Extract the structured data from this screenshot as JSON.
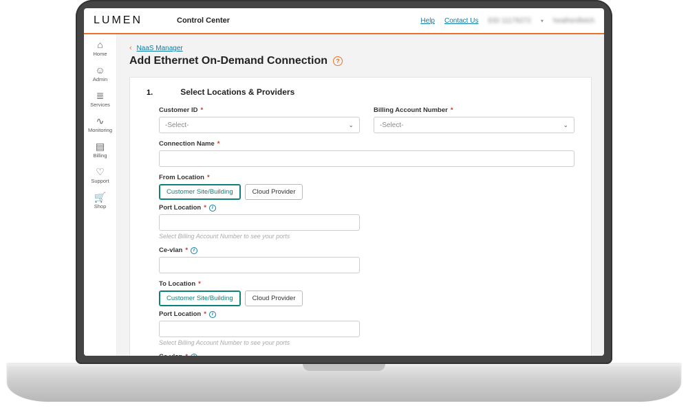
{
  "header": {
    "brand": "LUMEN",
    "app_name": "Control Center",
    "links": {
      "help": "Help",
      "contact": "Contact Us",
      "account_id": "EID 11179272",
      "user_name": "heathenfletch"
    }
  },
  "sidebar": [
    {
      "key": "home",
      "label": "Home",
      "icon": "⌂"
    },
    {
      "key": "admin",
      "label": "Admin",
      "icon": "☺"
    },
    {
      "key": "services",
      "label": "Services",
      "icon": "≣"
    },
    {
      "key": "monitoring",
      "label": "Monitoring",
      "icon": "∿"
    },
    {
      "key": "billing",
      "label": "Billing",
      "icon": "▤"
    },
    {
      "key": "support",
      "label": "Support",
      "icon": "♡"
    },
    {
      "key": "shop",
      "label": "Shop",
      "icon": "🛒"
    }
  ],
  "breadcrumb": {
    "back_label": "NaaS Manager"
  },
  "page_title": "Add Ethernet On-Demand Connection",
  "step": {
    "number": "1.",
    "title": "Select Locations & Providers"
  },
  "fields": {
    "customer_id": {
      "label": "Customer ID",
      "placeholder": "-Select-"
    },
    "billing_account": {
      "label": "Billing Account Number",
      "placeholder": "-Select-"
    },
    "connection_name": {
      "label": "Connection Name"
    },
    "from_location": {
      "label": "From Location",
      "options": {
        "site": "Customer Site/Building",
        "cloud": "Cloud Provider"
      }
    },
    "port_location": {
      "label": "Port Location",
      "hint": "Select Billing Account Number to see your ports"
    },
    "ce_vlan": {
      "label": "Ce-vlan"
    },
    "to_location": {
      "label": "To Location",
      "options": {
        "site": "Customer Site/Building",
        "cloud": "Cloud Provider"
      }
    }
  }
}
